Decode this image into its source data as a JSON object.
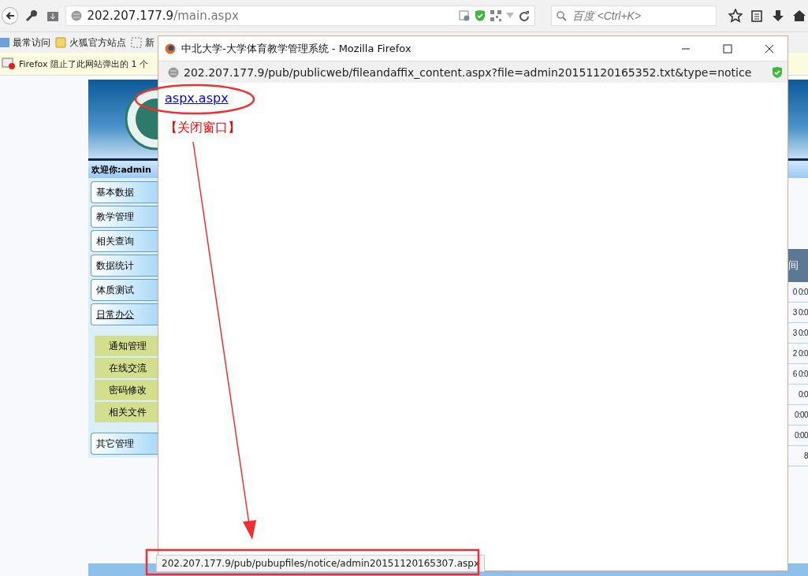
{
  "address_bar": {
    "host": "202.207.177.9",
    "path": "/main.aspx"
  },
  "search": {
    "placeholder": "百度 <Ctrl+K>"
  },
  "bookmarks": [
    {
      "kind": "history",
      "label": "最常访问"
    },
    {
      "kind": "folder",
      "label": "火狐官方站点"
    },
    {
      "kind": "page",
      "label": "新"
    }
  ],
  "notification": {
    "text": "Firefox 阻止了此网站弹出的 1 个"
  },
  "page": {
    "welcome": "欢迎你:admin",
    "menu": [
      {
        "label": "基本数据",
        "expanded": false
      },
      {
        "label": "教学管理",
        "expanded": false
      },
      {
        "label": "相关查询",
        "expanded": false
      },
      {
        "label": "数据统计",
        "expanded": false
      },
      {
        "label": "体质测试",
        "expanded": false
      },
      {
        "label": "日常办公",
        "expanded": true,
        "children": [
          {
            "label": "通知管理"
          },
          {
            "label": "在线交流"
          },
          {
            "label": "密码修改"
          },
          {
            "label": "相关文件"
          }
        ]
      },
      {
        "label": "其它管理",
        "expanded": false
      }
    ],
    "table": {
      "column_header": "间",
      "cells": [
        "0 0:0",
        "3 0:0",
        "3 0:0",
        "2 0:0",
        "6 0:0",
        "0:0",
        "0:00",
        "0:00",
        "8"
      ]
    }
  },
  "popup": {
    "title": "中北大学-大学体育教学管理系统 - Mozilla Firefox",
    "url": "202.207.177.9/pub/publicweb/fileandaffix_content.aspx?file=admin20151120165352.txt&type=notice",
    "link": "aspx.aspx",
    "close_link": "【关闭窗口】",
    "status_url": "202.207.177.9/pub/pubupfiles/notice/admin20151120165307.aspx"
  }
}
